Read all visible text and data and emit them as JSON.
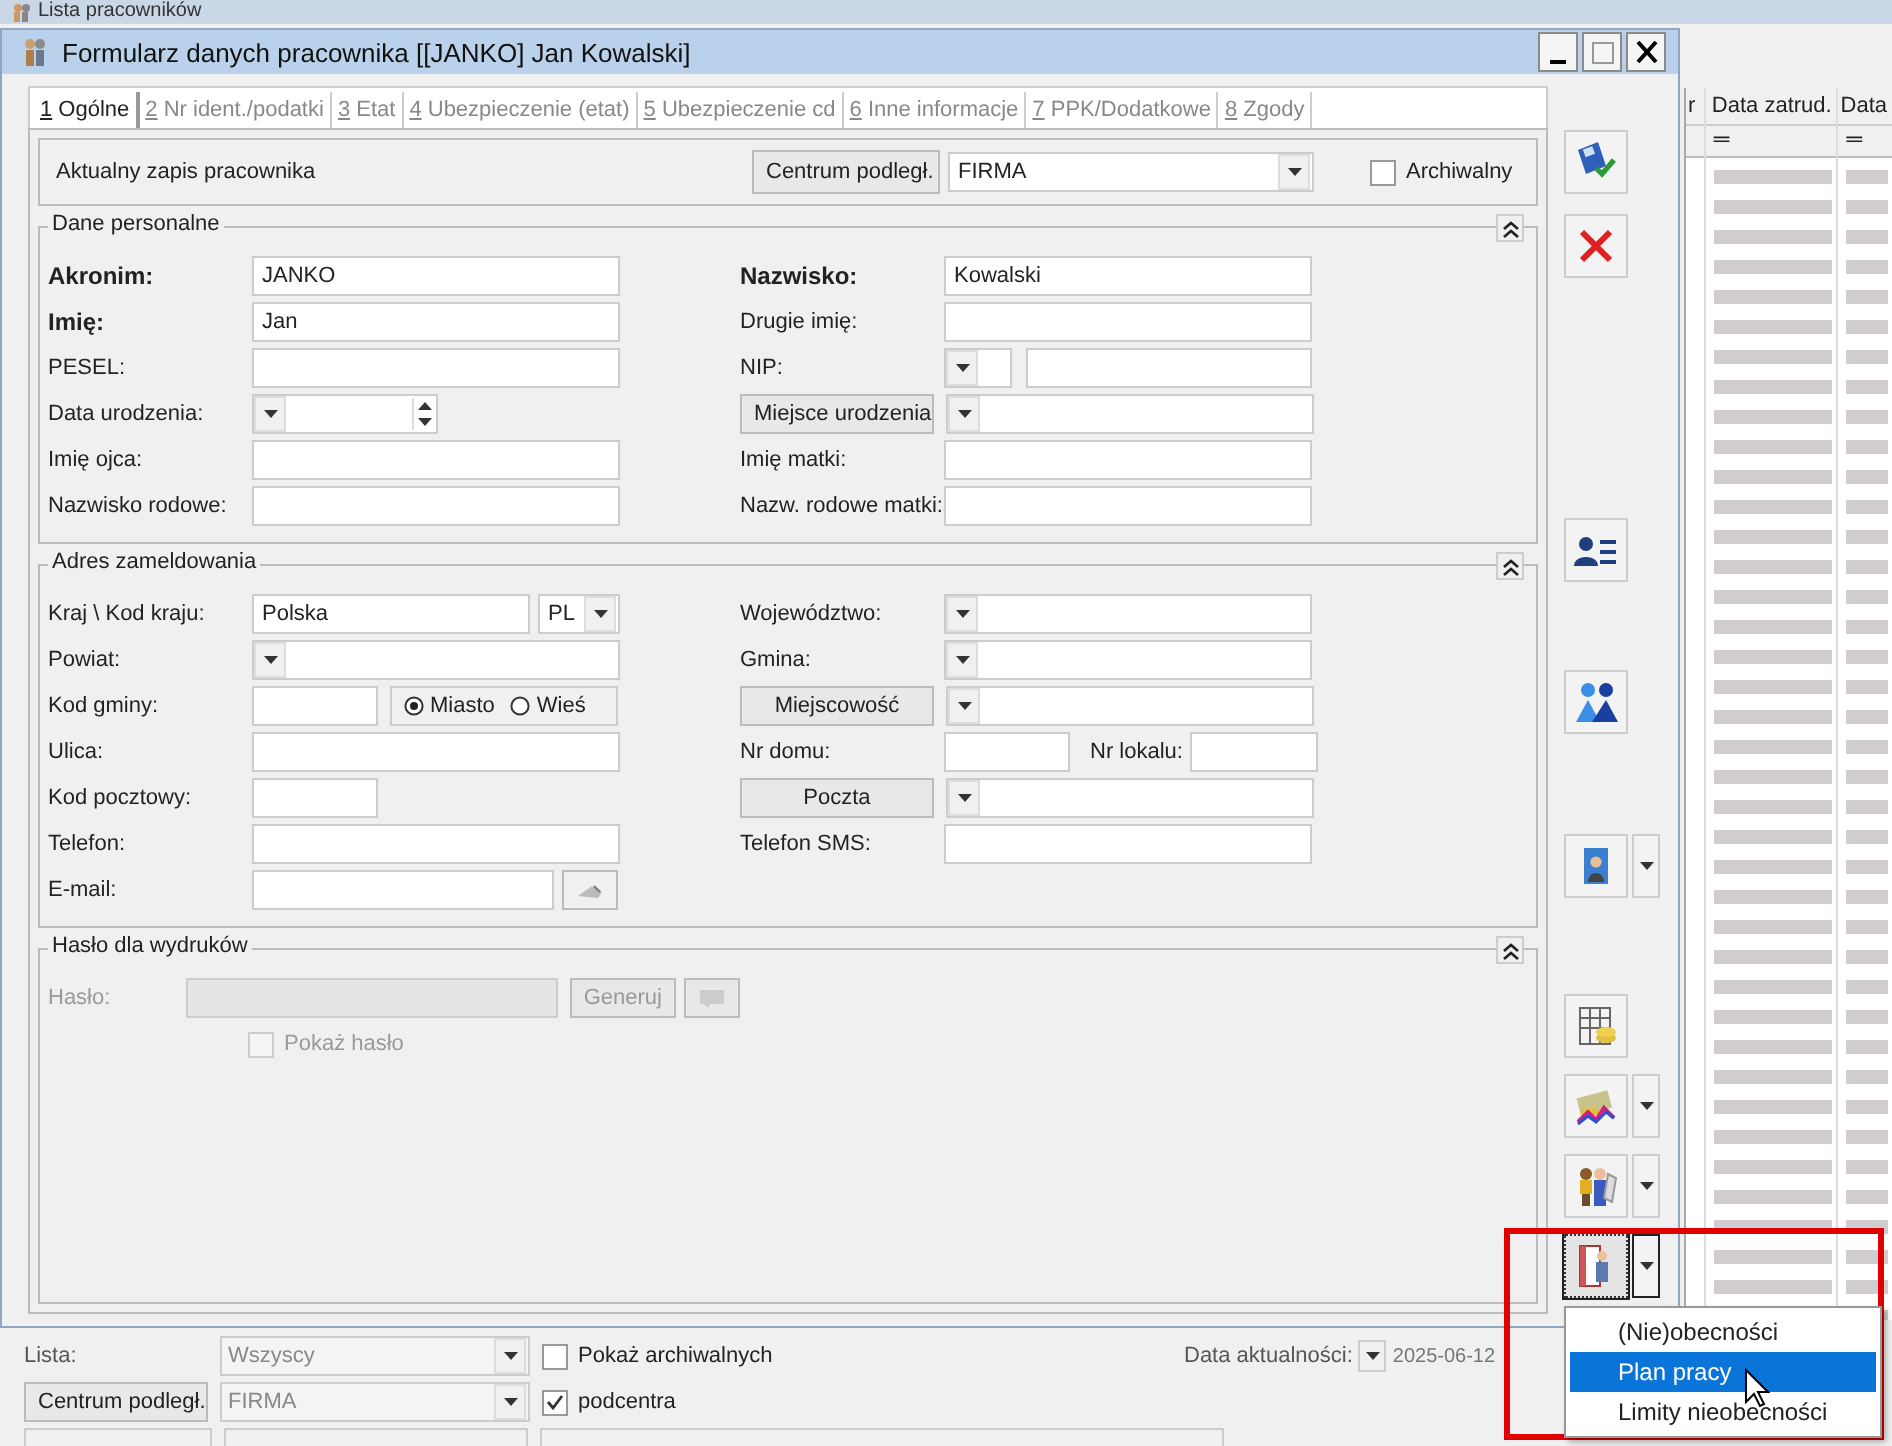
{
  "background_window": {
    "title": "Lista pracowników",
    "table": {
      "columns": [
        {
          "label": "r"
        },
        {
          "label": "Data zatrud.",
          "filter": "═"
        },
        {
          "label": "Data",
          "filter": "═"
        }
      ]
    },
    "filters": [
      {
        "label": "Lista:",
        "value": "Wszyscy",
        "checkbox": {
          "label": "Pokaż archiwalnych",
          "checked": false
        }
      },
      {
        "button": "Centrum podległ.",
        "value": "FIRMA",
        "checkbox": {
          "label": "podcentra",
          "checked": true
        }
      }
    ],
    "date": {
      "label": "Data aktualności:",
      "value": "2025-06-12"
    }
  },
  "window": {
    "title": "Formularz danych pracownika [[JANKO] Jan Kowalski]"
  },
  "tabs": [
    {
      "label": "1 Ogólne",
      "selected": true
    },
    {
      "label": "2 Nr ident./podatki",
      "selected": false
    },
    {
      "label": "3 Etat",
      "selected": false
    },
    {
      "label": "4 Ubezpieczenie (etat)",
      "selected": false
    },
    {
      "label": "5 Ubezpieczenie cd",
      "selected": false
    },
    {
      "label": "6 Inne informacje",
      "selected": false
    },
    {
      "label": "7 PPK/Dodatkowe",
      "selected": false
    },
    {
      "label": "8 Zgody",
      "selected": false
    }
  ],
  "header": {
    "text": "Aktualny zapis pracownika",
    "button": "Centrum podległ.",
    "value": "FIRMA",
    "checkbox": {
      "label": "Archiwalny",
      "checked": false
    }
  },
  "sections": [
    {
      "title": "Dane personalne",
      "left": [
        {
          "label": "Akronim:",
          "bold": true,
          "kind": "text",
          "value": "JANKO"
        },
        {
          "label": "Imię:",
          "bold": true,
          "kind": "text",
          "value": "Jan"
        },
        {
          "label": "PESEL:",
          "bold": false,
          "kind": "text"
        },
        {
          "label": "Data urodzenia:",
          "bold": false,
          "kind": "date"
        },
        {
          "label": "Imię ojca:",
          "bold": false,
          "kind": "text"
        },
        {
          "label": "Nazwisko rodowe:",
          "bold": false,
          "kind": "text"
        }
      ],
      "right": [
        {
          "label": "Nazwisko:",
          "bold": true,
          "kind": "text",
          "value": "Kowalski"
        },
        {
          "label": "Drugie imię:",
          "bold": false,
          "kind": "text"
        },
        {
          "label": "NIP:",
          "bold": false,
          "kind": "nip"
        },
        {
          "label": "Miejsce urodzenia",
          "kind": "lookup"
        },
        {
          "label": "Imię matki:",
          "bold": false,
          "kind": "text"
        },
        {
          "label": "Nazw. rodowe matki:",
          "bold": false,
          "kind": "text"
        }
      ]
    },
    {
      "title": "Adres zameldowania",
      "left": [
        {
          "label": "Kraj \\ Kod kraju:",
          "kind": "country",
          "value": "Polska",
          "code": "PL"
        },
        {
          "label": "Powiat:",
          "kind": "combo"
        },
        {
          "label": "Kod gminy:",
          "kind": "gmina",
          "options": [
            {
              "label": "Miasto",
              "selected": true
            },
            {
              "label": "Wieś",
              "selected": false
            }
          ]
        },
        {
          "label": "Ulica:",
          "kind": "text"
        },
        {
          "label": "Kod pocztowy:",
          "kind": "short"
        },
        {
          "label": "Telefon:",
          "kind": "text"
        },
        {
          "label": "E-mail:",
          "kind": "email"
        }
      ],
      "right": [
        {
          "label": "Województwo:",
          "kind": "combo"
        },
        {
          "label": "Gmina:",
          "kind": "combo"
        },
        {
          "label": "Miejscowość",
          "kind": "lookup"
        },
        {
          "label": "Nr domu:",
          "kind": "house",
          "extra_label": "Nr lokalu:"
        },
        {
          "label": "Poczta",
          "kind": "lookup"
        },
        {
          "label": "Telefon SMS:",
          "kind": "text"
        }
      ]
    },
    {
      "title": "Hasło dla wydruków",
      "left": [
        {
          "label": "Hasło:",
          "kind": "password",
          "button": "Generuj",
          "disabled": true
        }
      ],
      "checkbox": {
        "label": "Pokaż hasło",
        "checked": false,
        "disabled": true
      }
    }
  ],
  "toolbar": [
    {
      "split": false,
      "pressed": false
    },
    {
      "split": false,
      "pressed": false
    },
    {
      "split": false,
      "pressed": false
    },
    {
      "split": false,
      "pressed": false
    },
    {
      "split": true,
      "pressed": false
    },
    {
      "split": false,
      "pressed": false
    },
    {
      "split": true,
      "pressed": false
    },
    {
      "split": true,
      "pressed": false
    },
    {
      "split": true,
      "pressed": true
    }
  ],
  "menu": {
    "items": [
      {
        "label": "(Nie)obecności",
        "selected": false
      },
      {
        "label": "Plan pracy",
        "selected": true
      },
      {
        "label": "Limity nieobecności",
        "selected": false
      }
    ]
  }
}
